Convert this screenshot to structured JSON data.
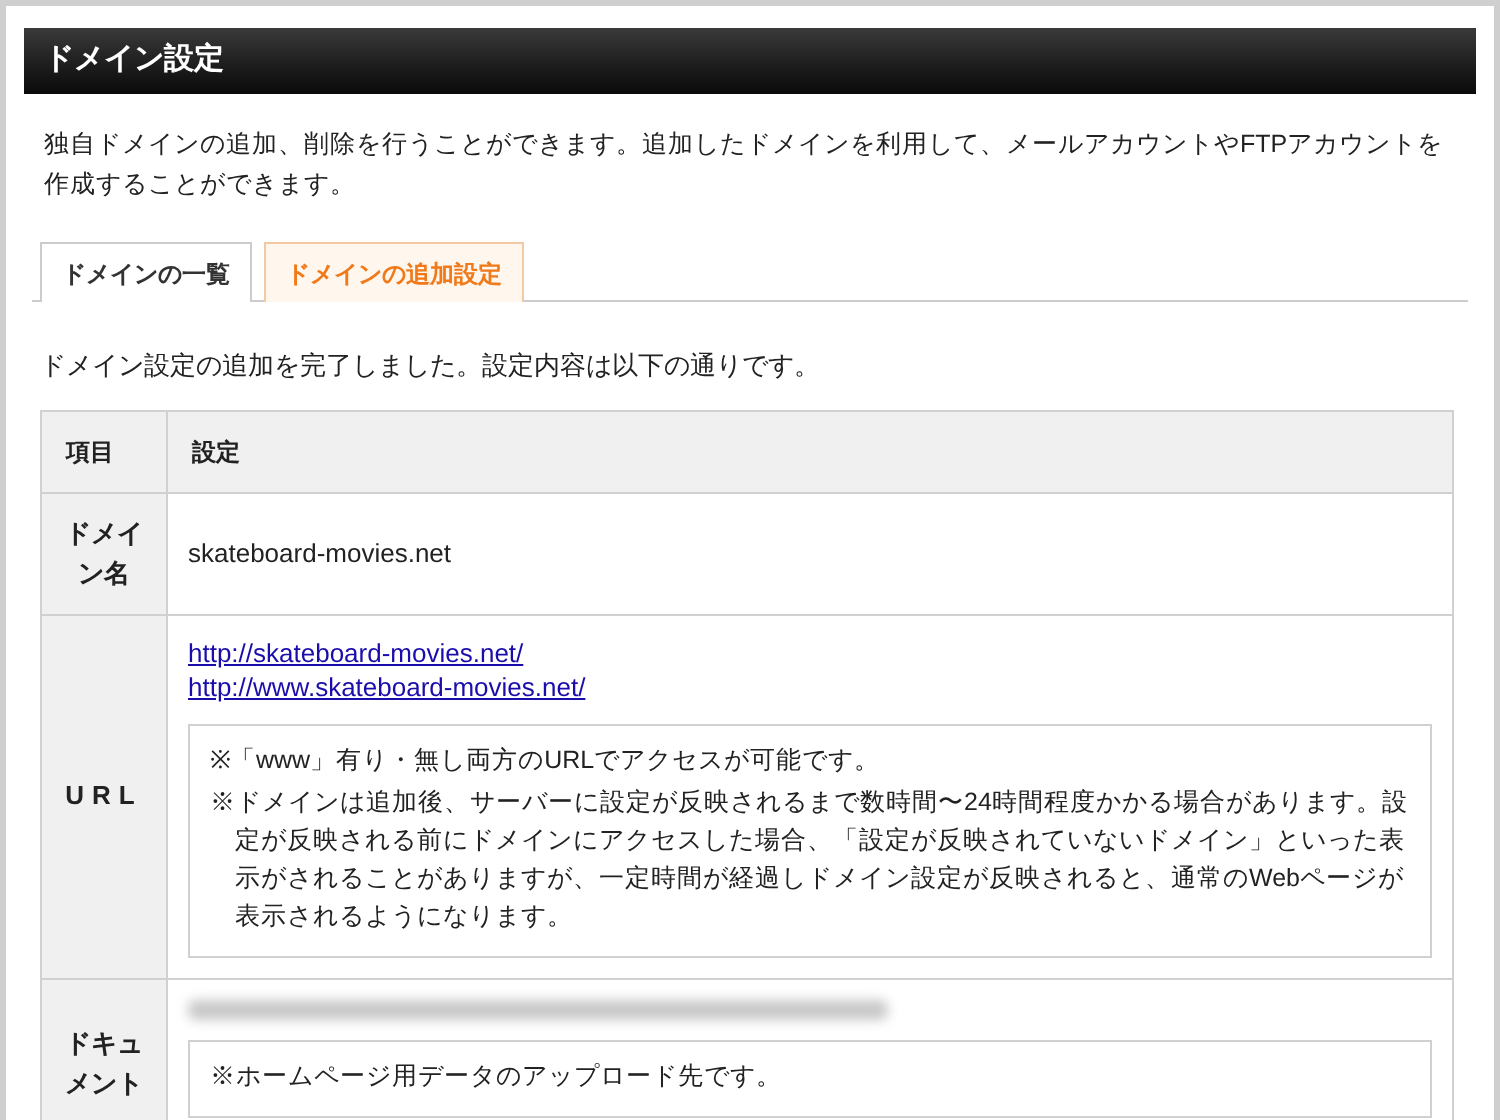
{
  "header": {
    "title": "ドメイン設定"
  },
  "description": "独自ドメインの追加、削除を行うことができます。追加したドメインを利用して、メールアカウントやFTPアカウントを作成することができます。",
  "tabs": [
    {
      "label": "ドメインの一覧",
      "selected": false
    },
    {
      "label": "ドメインの追加設定",
      "selected": true
    }
  ],
  "message": "ドメイン設定の追加を完了しました。設定内容は以下の通りです。",
  "table": {
    "columns": [
      "項目",
      "設定"
    ],
    "rows": [
      {
        "label": "ドメイン名",
        "kind": "text",
        "value": "skateboard-movies.net"
      },
      {
        "label": "URL",
        "kind": "links",
        "links": [
          "http://skateboard-movies.net/",
          "http://www.skateboard-movies.net/"
        ],
        "notes": [
          "※「www」有り・無し両方のURLでアクセスが可能です。",
          "※ドメインは追加後、サーバーに設定が反映されるまで数時間〜24時間程度かかる場合があります。設定が反映される前にドメインにアクセスした場合、「設定が反映されていないドメイン」といった表示がされることがありますが、一定時間が経過しドメイン設定が反映されると、通常のWebページが表示されるようになります。"
        ]
      },
      {
        "label": "ドキュメント",
        "kind": "blurred",
        "notes": [
          "※ホームページ用データのアップロード先です。"
        ]
      }
    ]
  }
}
